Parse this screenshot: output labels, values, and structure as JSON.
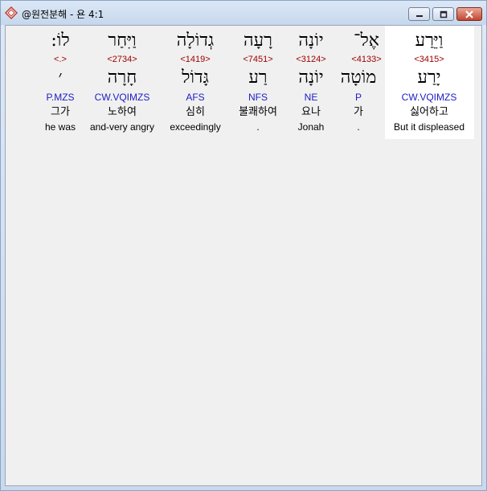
{
  "window": {
    "title": "@원전분해 - 욘 4:1",
    "minimize_label": "–",
    "restore_label": "▫",
    "close_label": "✕",
    "icon": "app-icon-red-diamond"
  },
  "words": [
    {
      "id": "w1",
      "heb": "וַיֵּרַע",
      "strong": "<3415>",
      "lex": "יָרַע",
      "morph": "CW.VQIMZS",
      "kor": "싫어하고",
      "eng": "But it displeased"
    },
    {
      "id": "w2",
      "heb": "אֶל־",
      "strong": "<4133>",
      "lex": "מוֹטָה",
      "morph": "P",
      "kor": "가",
      "eng": "."
    },
    {
      "id": "w3",
      "heb": "יוֹנָה",
      "strong": "<3124>",
      "lex": "יוֹנָה",
      "morph": "NE",
      "kor": "요나",
      "eng": "Jonah"
    },
    {
      "id": "w4",
      "heb": "רָעָה",
      "strong": "<7451>",
      "lex": "רַע",
      "morph": "NFS",
      "kor": "불쾌하여",
      "eng": "."
    },
    {
      "id": "w5",
      "heb": "גְדוֹלָה",
      "strong": "<1419>",
      "lex": "גָּדוֹל",
      "morph": "AFS",
      "kor": "심히",
      "eng": "exceedingly"
    },
    {
      "id": "w6",
      "heb": "וַיִּחַר",
      "strong": "<2734>",
      "lex": "חָרָה",
      "morph": "CW.VQIMZS",
      "kor": "노하여",
      "eng": "and-very angry"
    },
    {
      "id": "w7",
      "heb": "לוֹ:",
      "strong": "<.>",
      "lex": "׳",
      "morph": "P.MZS",
      "kor": "그가",
      "eng": "he was"
    }
  ]
}
